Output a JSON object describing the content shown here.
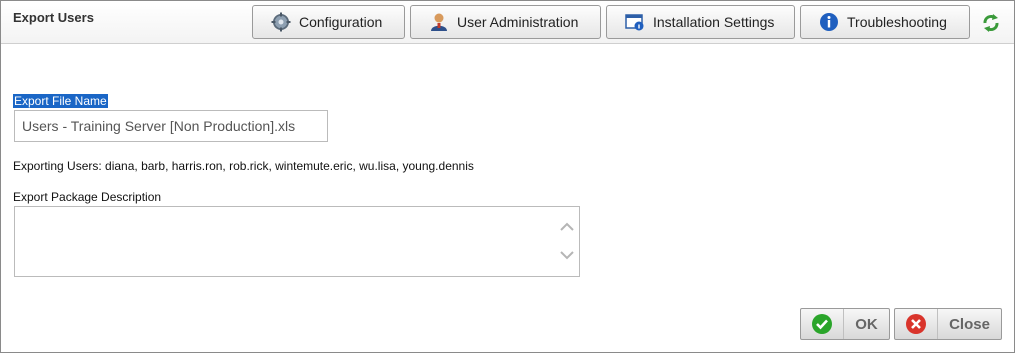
{
  "window": {
    "title": "Export Users"
  },
  "tabs": [
    {
      "label": "Configuration",
      "icon": "gear-icon"
    },
    {
      "label": "User Administration",
      "icon": "user-icon"
    },
    {
      "label": "Installation Settings",
      "icon": "settings-window-icon"
    },
    {
      "label": "Troubleshooting",
      "icon": "info-icon"
    }
  ],
  "refresh_icon": "refresh-icon",
  "form": {
    "file_name_label": "Export File Name",
    "file_name_value": "Users - Training Server [Non Production].xls",
    "exporting_users_text": "Exporting Users: diana, barb, harris.ron, rob.rick, wintemute.eric, wu.lisa, young.dennis",
    "package_description_label": "Export Package Description",
    "package_description_value": ""
  },
  "buttons": {
    "ok_label": "OK",
    "close_label": "Close"
  },
  "colors": {
    "selection": "#1a66c6",
    "ok_green": "#2aa52a",
    "close_red": "#d9342b",
    "info_blue": "#1f5fbf"
  }
}
